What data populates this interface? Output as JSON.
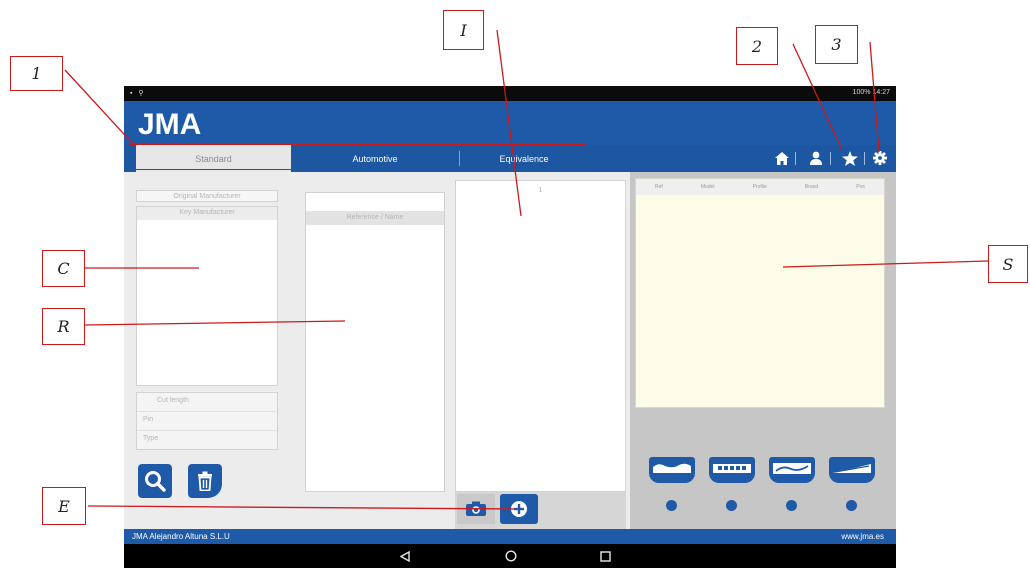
{
  "status_bar": {
    "right_text": "100% 14:27"
  },
  "header": {
    "logo_text": "JMA"
  },
  "tabs": [
    {
      "label": "Standard",
      "active": true
    },
    {
      "label": "Automotive",
      "active": false
    },
    {
      "label": "Equivalence",
      "active": false
    }
  ],
  "toolbar_icons": [
    "home-icon",
    "user-icon",
    "star-icon",
    "gear-icon"
  ],
  "left_panel": {
    "original_field": "Original Manufacturer",
    "key_manufacturer_field": "Key Manufacturer",
    "fields": [
      "Cut length",
      "Pin",
      "Type"
    ]
  },
  "reference_panel": {
    "header": "Reference / Name"
  },
  "image_panel": {
    "marker": "1"
  },
  "result_table": {
    "columns": [
      "Ref",
      "Model",
      "Profile",
      "Brand",
      "Pos"
    ]
  },
  "footer": {
    "left": "JMA Alejandro Altuna S.L.U",
    "right": "www.jma.es"
  },
  "colors": {
    "brand_blue": "#1e5aa8",
    "callout_red": "#cc1a1a"
  },
  "callouts": [
    "1",
    "I",
    "2",
    "3",
    "C",
    "R",
    "S",
    "E"
  ]
}
